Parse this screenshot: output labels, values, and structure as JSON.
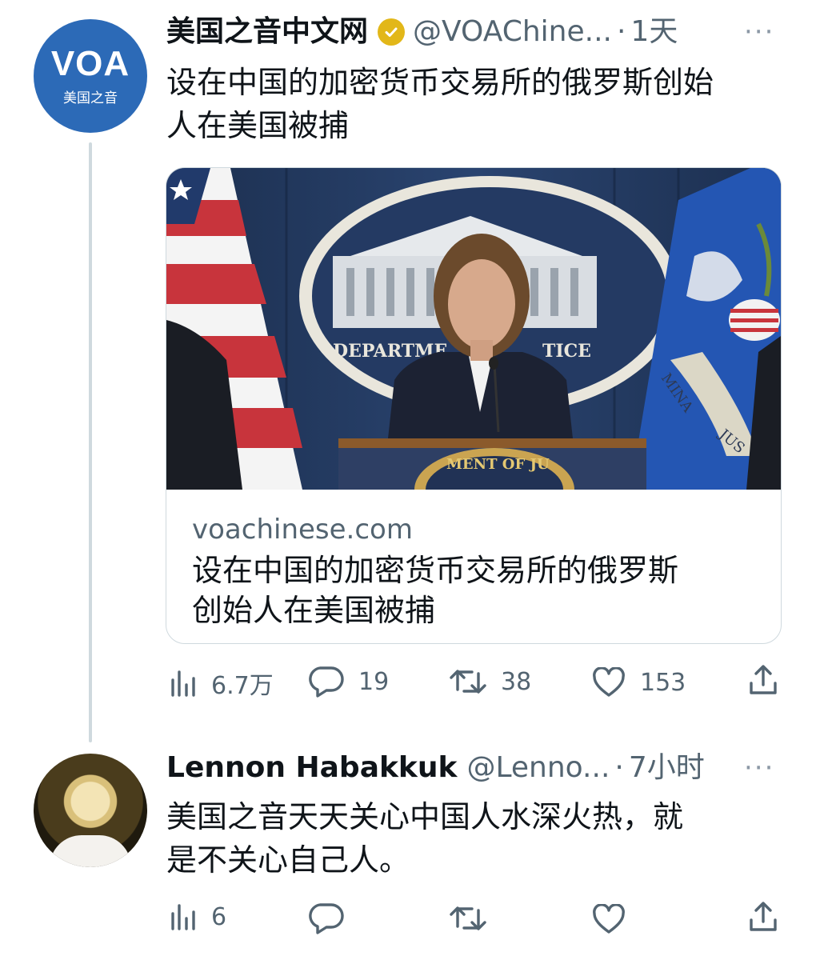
{
  "tweet1": {
    "avatar_text": {
      "logo": "VOA",
      "sub": "美国之音"
    },
    "name": "美国之音中文网",
    "handle": "@VOAChine...",
    "dot": "·",
    "time": "1天",
    "more": "···",
    "text_line1": "设在中国的加密货币交易所的俄罗斯创始",
    "text_line2": "人在美国被捕",
    "card": {
      "photo_text": {
        "seal_left": "DEPARTME",
        "seal_right": "TICE",
        "podium": "MENT OF JU",
        "flag_text1": "JUS",
        "flag_text2": "MINA"
      },
      "domain": "voachinese.com",
      "title_line1": "设在中国的加密货币交易所的俄罗斯",
      "title_line2": "创始人在美国被捕"
    },
    "stats": {
      "views": "6.7万",
      "replies": "19",
      "retweets": "38",
      "likes": "153"
    }
  },
  "tweet2": {
    "name": "Lennon Habakkuk",
    "handle": "@Lenno...",
    "dot": "·",
    "time": "7小时",
    "more": "···",
    "text_line1": "美国之音天天关心中国人水深火热，就",
    "text_line2": "是不关心自己人。",
    "stats": {
      "views": "6"
    }
  },
  "colors": {
    "accent_blue": "#2c6ab7",
    "verified_gold": "#e2b719",
    "secondary_text": "#536471",
    "thread_line": "#cfd9de"
  },
  "icons": [
    "views-icon",
    "reply-icon",
    "retweet-icon",
    "like-icon",
    "share-icon",
    "verified-badge-icon",
    "more-icon"
  ]
}
